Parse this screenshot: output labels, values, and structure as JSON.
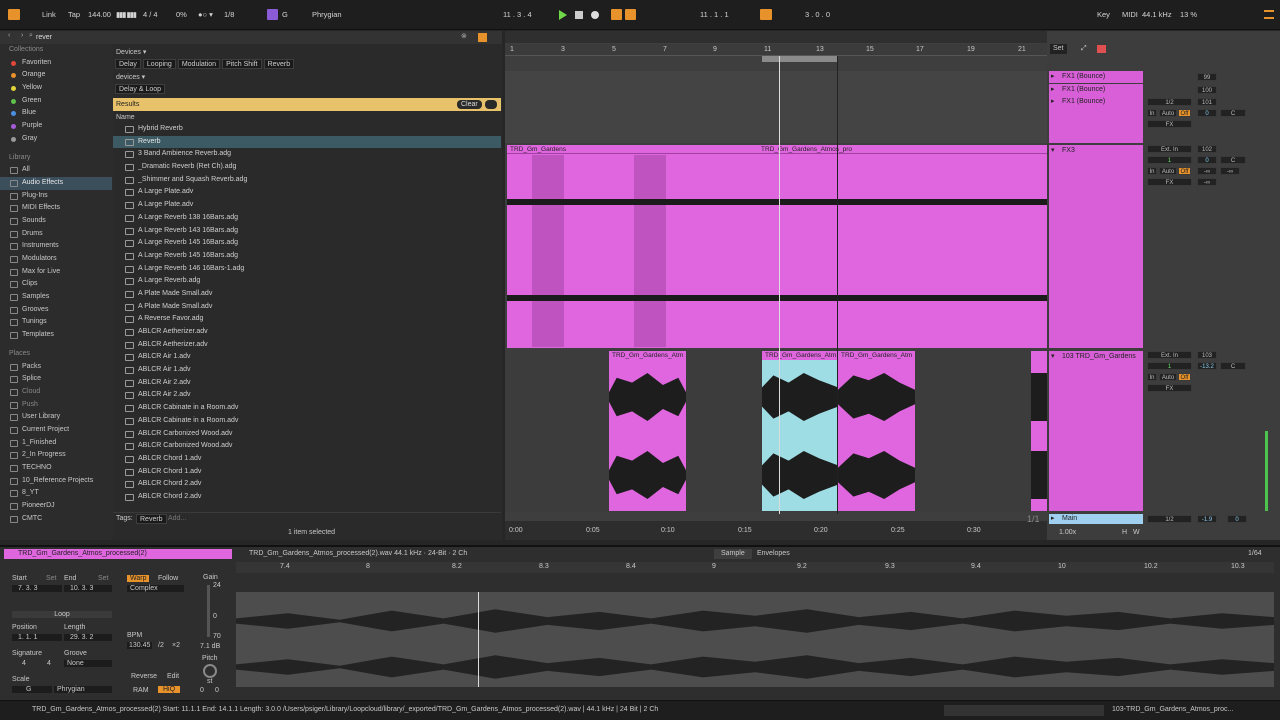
{
  "transport": {
    "link": "Link",
    "tap": "Tap",
    "tempo": "144.00",
    "signature": "4 / 4",
    "cpu_pct": "0%",
    "quantize": "1/8",
    "key_root": "G",
    "scale": "Phrygian",
    "position": "11 .  3 .  4",
    "loop_start": "11 .  1 .  1",
    "loop_length": "3 .  0 .  0",
    "key_label": "Key",
    "midi_label": "MIDI",
    "sample_rate": "44.1 kHz",
    "cpu_load": "13 %"
  },
  "browser": {
    "search_value": "rever",
    "breadcrumb_top": "Devices ▾",
    "filters": [
      "Delay",
      "Looping",
      "Modulation",
      "Pitch Shift",
      "Reverb"
    ],
    "devices_label": "devices ▾",
    "delay_loop": "Delay & Loop",
    "results_label": "Results",
    "clear_label": "Clear",
    "name_header": "Name",
    "items": [
      "Hybrid Reverb",
      "Reverb",
      "3 Band Ambience Reverb.adg",
      "_Dramatic Reverb (Ret Ch).adg",
      "_Shimmer and Squash Reverb.adg",
      "A Large Plate.adv",
      "A Large Plate.adv",
      "A Large Reverb 138 16Bars.adg",
      "A Large Reverb 143 16Bars.adg",
      "A Large Reverb 145 16Bars.adg",
      "A Large Reverb 145 16Bars.adg",
      "A Large Reverb 146 16Bars-1.adg",
      "A Large Reverb.adg",
      "A Plate Made Small.adv",
      "A Plate Made Small.adv",
      "A Reverse Favor.adg",
      "ABLCR Aetherizer.adv",
      "ABLCR Aetherizer.adv",
      "ABLCR Air 1.adv",
      "ABLCR Air 1.adv",
      "ABLCR Air 2.adv",
      "ABLCR Air 2.adv",
      "ABLCR Cabinate in a Room.adv",
      "ABLCR Cabinate in a Room.adv",
      "ABLCR Carbonized Wood.adv",
      "ABLCR Carbonized Wood.adv",
      "ABLCR Chord 1.adv",
      "ABLCR Chord 1.adv",
      "ABLCR Chord 2.adv",
      "ABLCR Chord 2.adv"
    ],
    "tags_label": "Tags:",
    "tag": "Reverb",
    "tag_add": "Add...",
    "selection_status": "1 item selected"
  },
  "sidebar": {
    "collections_header": "Collections",
    "collections": [
      {
        "label": "Favoriten",
        "color": "#e0483c"
      },
      {
        "label": "Orange",
        "color": "#e8902e"
      },
      {
        "label": "Yellow",
        "color": "#e3d23a"
      },
      {
        "label": "Green",
        "color": "#5fc04b"
      },
      {
        "label": "Blue",
        "color": "#4a8fe0"
      },
      {
        "label": "Purple",
        "color": "#a65bd8"
      },
      {
        "label": "Gray",
        "color": "#9a9a9a"
      }
    ],
    "library_header": "Library",
    "library": [
      "All",
      "Audio Effects",
      "Plug-Ins",
      "MIDI Effects",
      "Sounds",
      "Drums",
      "Instruments",
      "Modulators",
      "Max for Live",
      "Clips",
      "Samples",
      "Grooves",
      "Tunings",
      "Templates"
    ],
    "places_header": "Places",
    "places": [
      "Packs",
      "Splice",
      "Cloud",
      "Push",
      "User Library",
      "Current Project",
      "1_Finished",
      "2_In Progress",
      "TECHNO",
      "10_Reference Projects",
      "8_YT",
      "PioneerDJ",
      "CMTC"
    ]
  },
  "arrangement": {
    "bar_numbers": [
      "1",
      "3",
      "5",
      "7",
      "9",
      "11",
      "13",
      "15",
      "17",
      "19",
      "21"
    ],
    "time_labels": [
      "0:00",
      "0:05",
      "0:10",
      "0:15",
      "0:20",
      "0:25",
      "0:30"
    ],
    "clip_name": "TRD_Gm_Gardens",
    "atmos_clip": "TRD_Gm_Gardens_Atmos_pro",
    "atm_clip": "TRD_Gm_Gardens_Atm",
    "zoom": "1/1"
  },
  "tracks": [
    {
      "name": "FX1 (Bounce)",
      "vol": "99"
    },
    {
      "name": "FX1 (Bounce)",
      "vol": "100"
    },
    {
      "name": "FX1 (Bounce)",
      "vol": "101",
      "input": "1/2",
      "send": "0",
      "mon": "C"
    },
    {
      "name": "FX3",
      "vol": "102",
      "input": "Ext. In",
      "ch": "1",
      "send": "0",
      "mon": "C"
    },
    {
      "name": "103 TRD_Gm_Gardens",
      "vol": "103",
      "input": "Ext. In",
      "ch": "1",
      "send": "-13.2",
      "mon": "C"
    }
  ],
  "mixer": {
    "set_label": "Set",
    "in": "In",
    "auto": "Auto",
    "off": "Off",
    "fx": "FX",
    "inf": "-∞",
    "main_label": "Main",
    "main_route": "1/2",
    "main_vol": "-1.9",
    "main_pan": "0",
    "tempo_factor": "1.00x",
    "h": "H",
    "w": "W"
  },
  "clip_detail": {
    "clip_title": "TRD_Gm_Gardens_Atmos_processed(2)",
    "file_info": "TRD_Gm_Gardens_Atmos_processed(2).wav  44.1 kHz · 24-Bit · 2 Ch",
    "sample_tab": "Sample",
    "envelopes_tab": "Envelopes",
    "grid": "1/64",
    "start_label": "Start",
    "end_label": "End",
    "set_label": "Set",
    "start_value": "7.  3.  3",
    "end_value": "10.  3.  3",
    "loop_label": "Loop",
    "position_label": "Position",
    "length_label": "Length",
    "position_value": "1.  1.  1",
    "length_value": "29.  3.  2",
    "signature_label": "Signature",
    "groove_label": "Groove",
    "sig_num": "4",
    "sig_den": "4",
    "groove_value": "None",
    "scale_label": "Scale",
    "scale_root": "G",
    "scale_value": "Phrygian",
    "warp": "Warp",
    "follow": "Follow",
    "warp_mode": "Complex",
    "bpm_label": "BPM",
    "bpm_value": "130.45",
    "half": "/2",
    "double": "×2",
    "reverse": "Reverse",
    "edit": "Edit",
    "ram": "RAM",
    "hiq": "HiQ",
    "gain_label": "Gain",
    "gain_top": "24",
    "gain_zero": "0",
    "gain_bottom": "70",
    "gain_value": "7.1 dB",
    "pitch_label": "Pitch",
    "pitch_unit": "st",
    "pitch_st": "0",
    "pitch_ct": "0",
    "ruler": [
      "7.4",
      "8",
      "8.2",
      "8.3",
      "8.4",
      "9",
      "9.2",
      "9.3",
      "9.4",
      "10",
      "10.2",
      "10.3"
    ]
  },
  "statusbar": {
    "text": "TRD_Gm_Gardens_Atmos_processed(2)  Start: 11.1.1  End: 14.1.1  Length: 3.0.0  /Users/psiger/Library/Loopcloud/library/_exported/TRD_Gm_Gardens_Atmos_processed(2).wav | 44.1 kHz | 24 Bit | 2 Ch",
    "track": "103-TRD_Gm_Gardens_Atmos_proc..."
  },
  "colors": {
    "accent": "#e7922b",
    "clip": "#e066e0",
    "clip_selected": "#9fdde4",
    "results": "#e8c26a"
  }
}
